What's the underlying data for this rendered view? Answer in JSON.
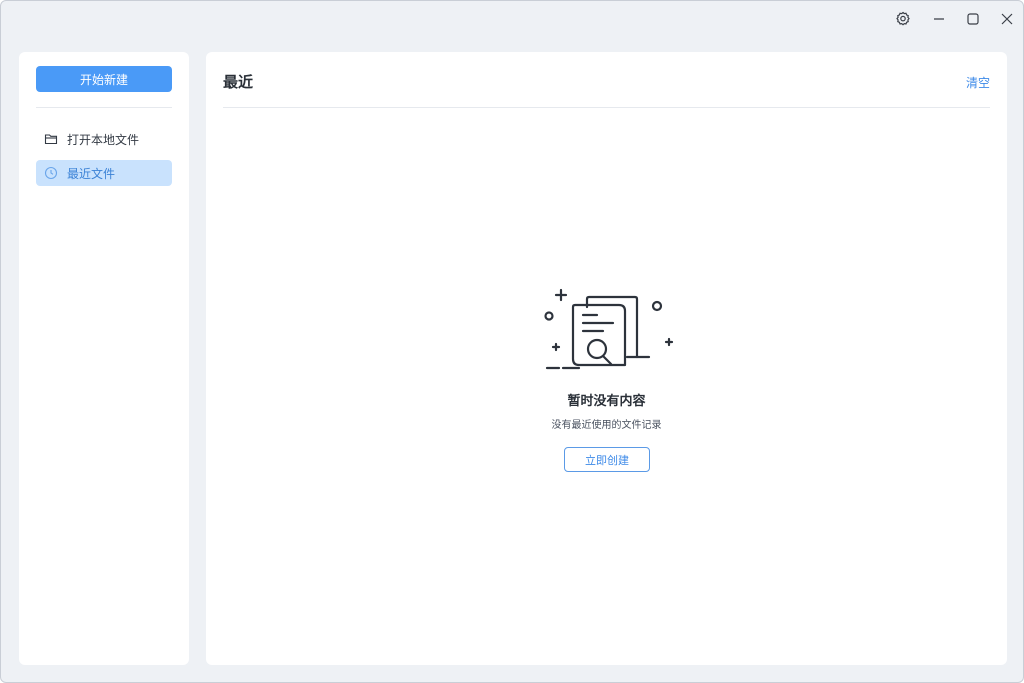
{
  "titlebar": {
    "icons": [
      "settings-icon",
      "minimize-icon",
      "maximize-icon",
      "close-icon"
    ]
  },
  "sidebar": {
    "new_button_label": "开始新建",
    "items": [
      {
        "label": "打开本地文件",
        "icon": "folder-icon",
        "active": false
      },
      {
        "label": "最近文件",
        "icon": "clock-icon",
        "active": true
      }
    ]
  },
  "main": {
    "title": "最近",
    "clear_label": "清空",
    "empty": {
      "title": "暂时没有内容",
      "subtitle": "没有最近使用的文件记录",
      "button_label": "立即创建",
      "illustration": "document-search-illustration"
    }
  },
  "colors": {
    "accent": "#4a9af7",
    "active_item_bg": "#c9e2fd",
    "link": "#3d8ae8",
    "background": "#eef1f5"
  }
}
